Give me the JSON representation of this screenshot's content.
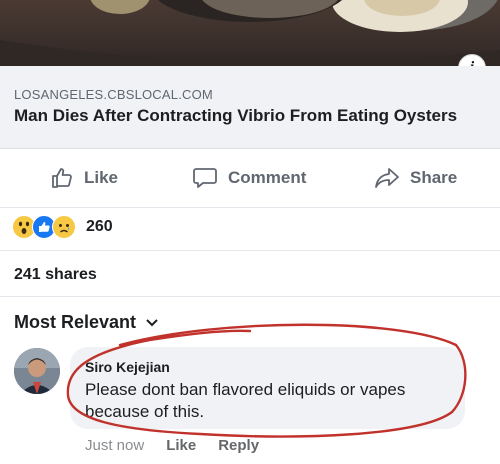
{
  "link_preview": {
    "domain": "LOSANGELES.CBSLOCAL.COM",
    "title": "Man Dies After Contracting Vibrio From Eating Oysters",
    "info_badge": "i"
  },
  "actions": {
    "like_label": "Like",
    "comment_label": "Comment",
    "share_label": "Share"
  },
  "reactions": {
    "icons": [
      "wow",
      "like",
      "sad"
    ],
    "count": "260"
  },
  "shares_text": "241 shares",
  "sort": {
    "label": "Most Relevant"
  },
  "comment": {
    "author": "Siro Kejejian",
    "text": "Please dont ban flavored eliquids or vapes because of this.",
    "time": "Just now",
    "like_label": "Like",
    "reply_label": "Reply"
  },
  "colors": {
    "action_gray": "#606770",
    "bubble_bg": "#f0f2f5",
    "annotation_red": "#c0322b",
    "like_blue": "#1877f2"
  }
}
